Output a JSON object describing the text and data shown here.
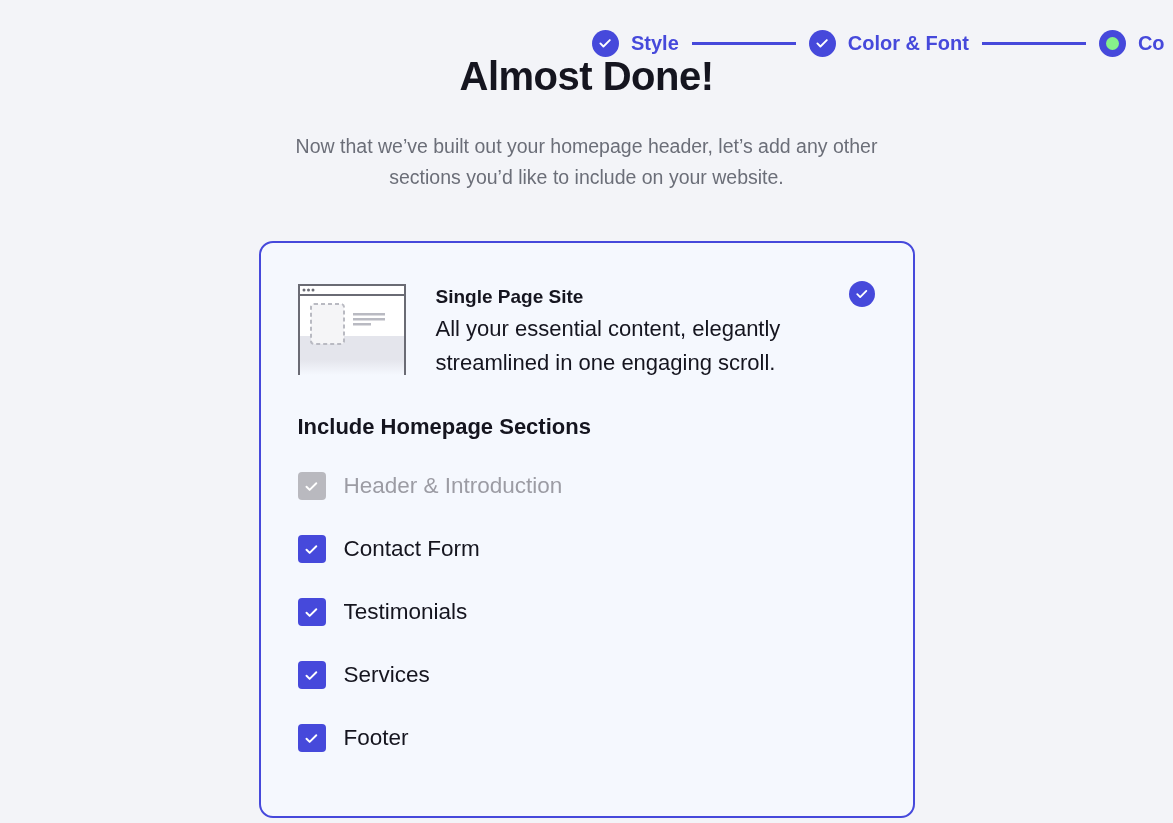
{
  "stepper": [
    {
      "label": "Style",
      "completed": true
    },
    {
      "label": "Color & Font",
      "completed": true
    },
    {
      "label": "Co",
      "completed": false
    }
  ],
  "heading": "Almost Done!",
  "intro": "Now that we’ve built out your homepage header, let’s add any other sections you’d like to include on your website.",
  "site_option": {
    "title": "Single Page Site",
    "description": "All your essential content, elegantly streamlined in one engaging scroll.",
    "selected": true
  },
  "sections_heading": "Include Homepage Sections",
  "sections": [
    {
      "label": "Header & Introduction",
      "checked": true,
      "disabled": true
    },
    {
      "label": "Contact Form",
      "checked": true,
      "disabled": false
    },
    {
      "label": "Testimonials",
      "checked": true,
      "disabled": false
    },
    {
      "label": "Services",
      "checked": true,
      "disabled": false
    },
    {
      "label": "Footer",
      "checked": true,
      "disabled": false
    }
  ]
}
